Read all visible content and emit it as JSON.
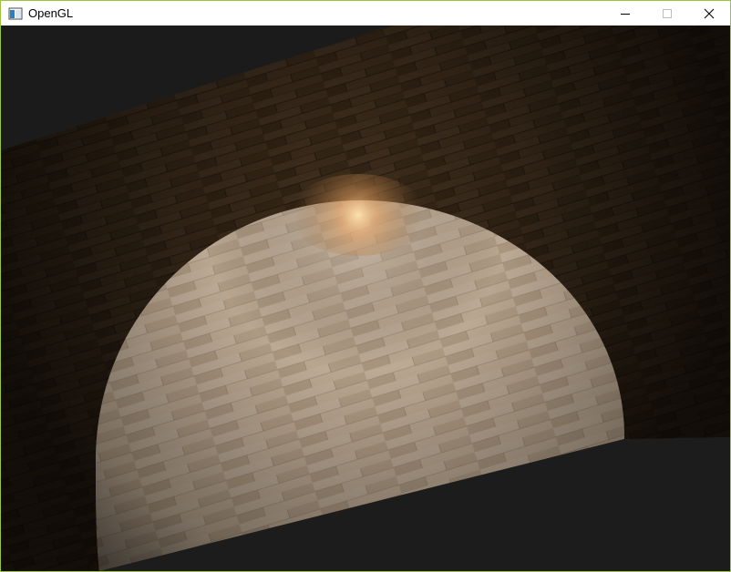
{
  "window": {
    "title": "OpenGL",
    "border_color": "#9bc43c",
    "titlebar_color": "#ffffff"
  },
  "controls": {
    "minimize_icon": "minimize-icon",
    "maximize_icon": "maximize-icon",
    "close_icon": "close-icon"
  },
  "scene": {
    "clear_color": "#1b1b1b",
    "floor_color": "#3a2a1a",
    "sphere_color": "#b8a48f",
    "light_color": "#ffc98a"
  }
}
